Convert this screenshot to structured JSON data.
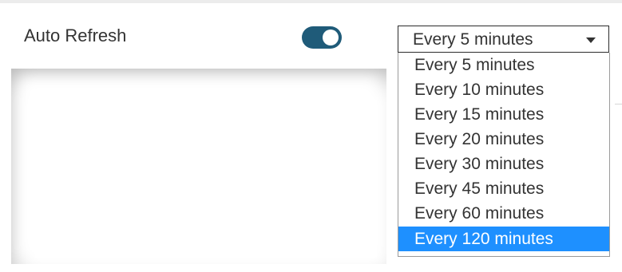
{
  "settings": {
    "auto_refresh_label": "Auto Refresh",
    "toggle_state": "on",
    "accent_color": "#1f5b79"
  },
  "interval_select": {
    "current_value": "Every 5 minutes",
    "highlight_color": "#1e90ff",
    "options": [
      "Every 5 minutes",
      "Every 10 minutes",
      "Every 15 minutes",
      "Every 20 minutes",
      "Every 30 minutes",
      "Every 45 minutes",
      "Every 60 minutes",
      "Every 120 minutes"
    ],
    "highlighted_option": "Every 120 minutes"
  }
}
